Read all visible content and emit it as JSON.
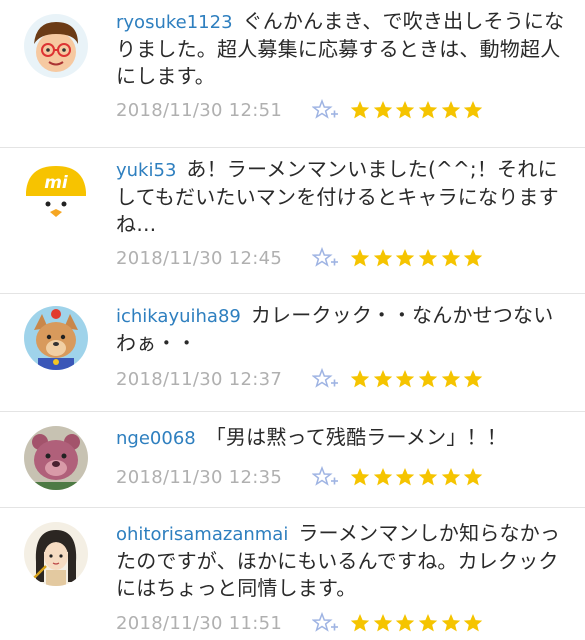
{
  "colors": {
    "username": "#2e7fbf",
    "timestamp": "#b0b0b0",
    "star": "#f5c400",
    "rate_icon": "#9fb4e3",
    "divider": "#e4e4e4"
  },
  "comments": [
    {
      "username": "ryosuke1123",
      "text": "ぐんかんまき、で吹き出しそうになりました。超人募集に応募するときは、動物超人にします。",
      "timestamp": "2018/11/30 12:51",
      "stars": 6,
      "avatar_icon": "glasses-boy-avatar-icon"
    },
    {
      "username": "yuki53",
      "text": "あ！ラーメンマンいました(^^;！それにしてもだいたいマンを付けるとキャラになりますね…",
      "timestamp": "2018/11/30 12:45",
      "stars": 6,
      "avatar_icon": "yellow-chick-mi-avatar-icon"
    },
    {
      "username": "ichikayuiha89",
      "text": "カレークック・・なんかせつないわぁ・・",
      "timestamp": "2018/11/30 12:37",
      "stars": 6,
      "avatar_icon": "dog-costume-avatar-icon"
    },
    {
      "username": "nge0068",
      "text": "「男は黙って残酷ラーメン」！！",
      "timestamp": "2018/11/30 12:35",
      "stars": 6,
      "avatar_icon": "pink-bear-avatar-icon"
    },
    {
      "username": "ohitorisamazanmai",
      "text": "ラーメンマンしか知らなかったのですが、ほかにもいるんですね。カレクックにはちょっと同情します。",
      "timestamp": "2018/11/30 11:51",
      "stars": 6,
      "avatar_icon": "girl-illustration-avatar-icon"
    }
  ]
}
